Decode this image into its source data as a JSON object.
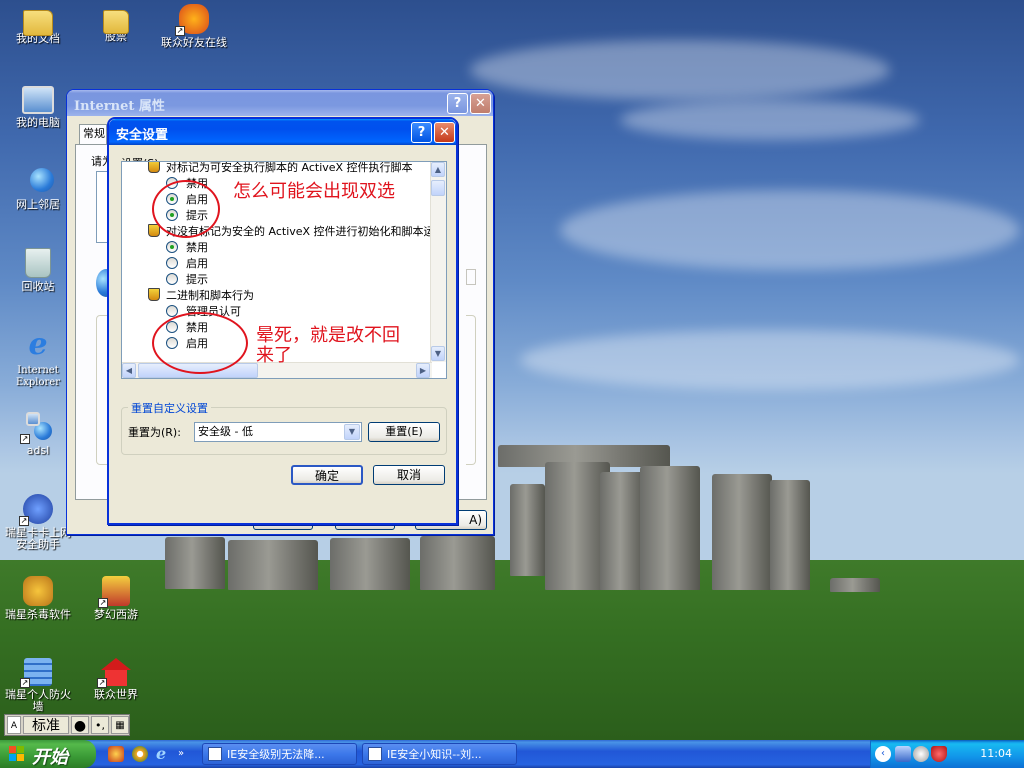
{
  "desktop": {
    "icons": [
      {
        "label": "我的文档"
      },
      {
        "label": "股票"
      },
      {
        "label": "联众好友在线"
      },
      {
        "label": "我的电脑"
      },
      {
        "label": "网上邻居"
      },
      {
        "label": "回收站"
      },
      {
        "label": "Internet Explorer"
      },
      {
        "label": "adsl"
      },
      {
        "label": "瑞星卡卡上网安全助手"
      },
      {
        "label": "瑞星杀毒软件"
      },
      {
        "label": "梦幻西游"
      },
      {
        "label": "瑞星个人防火墙"
      },
      {
        "label": "联众世界"
      }
    ]
  },
  "internet_props": {
    "title": "Internet 属性",
    "tab_general": "常规",
    "text_fragment": "请为",
    "btn_fragment": "A)"
  },
  "security_dialog": {
    "title": "安全设置",
    "settings_label": "设置(S):",
    "tree": [
      {
        "type": "header",
        "text": "对标记为可安全执行脚本的 ActiveX 控件执行脚本"
      },
      {
        "type": "radio",
        "text": "禁用",
        "checked": false
      },
      {
        "type": "radio",
        "text": "启用",
        "checked": true
      },
      {
        "type": "radio",
        "text": "提示",
        "checked": true
      },
      {
        "type": "header",
        "text": "对没有标记为安全的 ActiveX 控件进行初始化和脚本运行"
      },
      {
        "type": "radio",
        "text": "禁用",
        "checked": true
      },
      {
        "type": "radio",
        "text": "启用",
        "checked": false
      },
      {
        "type": "radio",
        "text": "提示",
        "checked": false
      },
      {
        "type": "header",
        "text": "二进制和脚本行为"
      },
      {
        "type": "radio",
        "text": "管理员认可",
        "checked": false
      },
      {
        "type": "radio",
        "text": "禁用",
        "checked": false
      },
      {
        "type": "radio",
        "text": "启用",
        "checked": false
      }
    ],
    "reset_group_label": "重置自定义设置",
    "reset_to_label": "重置为(R):",
    "reset_level": "安全级 - 低",
    "reset_button": "重置(E)",
    "ok_button": "确定",
    "cancel_button": "取消"
  },
  "annotations": {
    "note1": "怎么可能会出现双选",
    "note2": "晕死，就是改不回来了",
    "color": "#e0141e"
  },
  "language_bar": {
    "ime_name": "标准"
  },
  "taskbar": {
    "start_label": "开始",
    "tasks": [
      {
        "label": "IE安全级别无法降..."
      },
      {
        "label": "IE安全小知识--刘..."
      }
    ],
    "clock": "11:04"
  },
  "colors": {
    "xp_blue": "#0054e3",
    "dialog_face": "#ece9d8",
    "start_green": "#3a9a36",
    "annotation_red": "#e0141e"
  }
}
